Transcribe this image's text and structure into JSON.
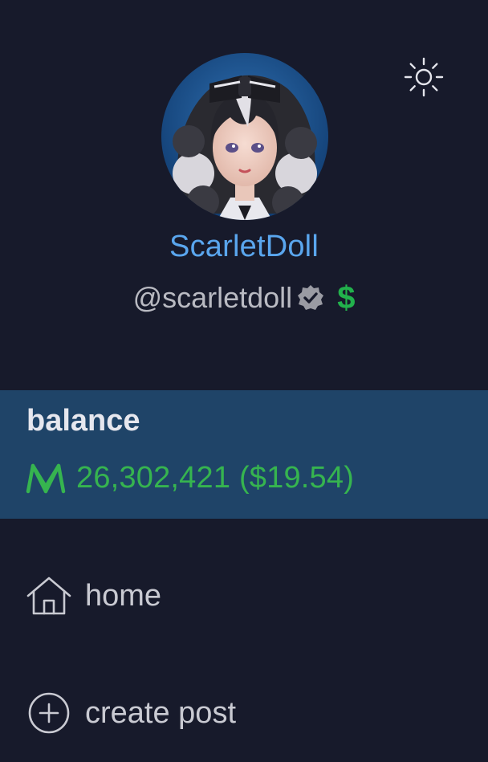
{
  "profile": {
    "display_name": "ScarletDoll",
    "handle": "@scarletdoll",
    "verified": true,
    "dollar_badge": "$",
    "avatar_icon": "avatar-image"
  },
  "theme_toggle": {
    "icon": "sun-icon"
  },
  "balance": {
    "label": "balance",
    "amount": "26,302,421 ($19.54)",
    "currency_icon": "mana-icon"
  },
  "nav": {
    "items": [
      {
        "label": "home",
        "icon": "home-icon"
      },
      {
        "label": "create post",
        "icon": "plus-circle-icon"
      }
    ]
  },
  "colors": {
    "background": "#171a2b",
    "name": "#5aa6ee",
    "balance_band": "#1f4468",
    "balance_green": "#36b44f",
    "dollar_green": "#22b14c",
    "muted_text": "#b9bac2"
  }
}
